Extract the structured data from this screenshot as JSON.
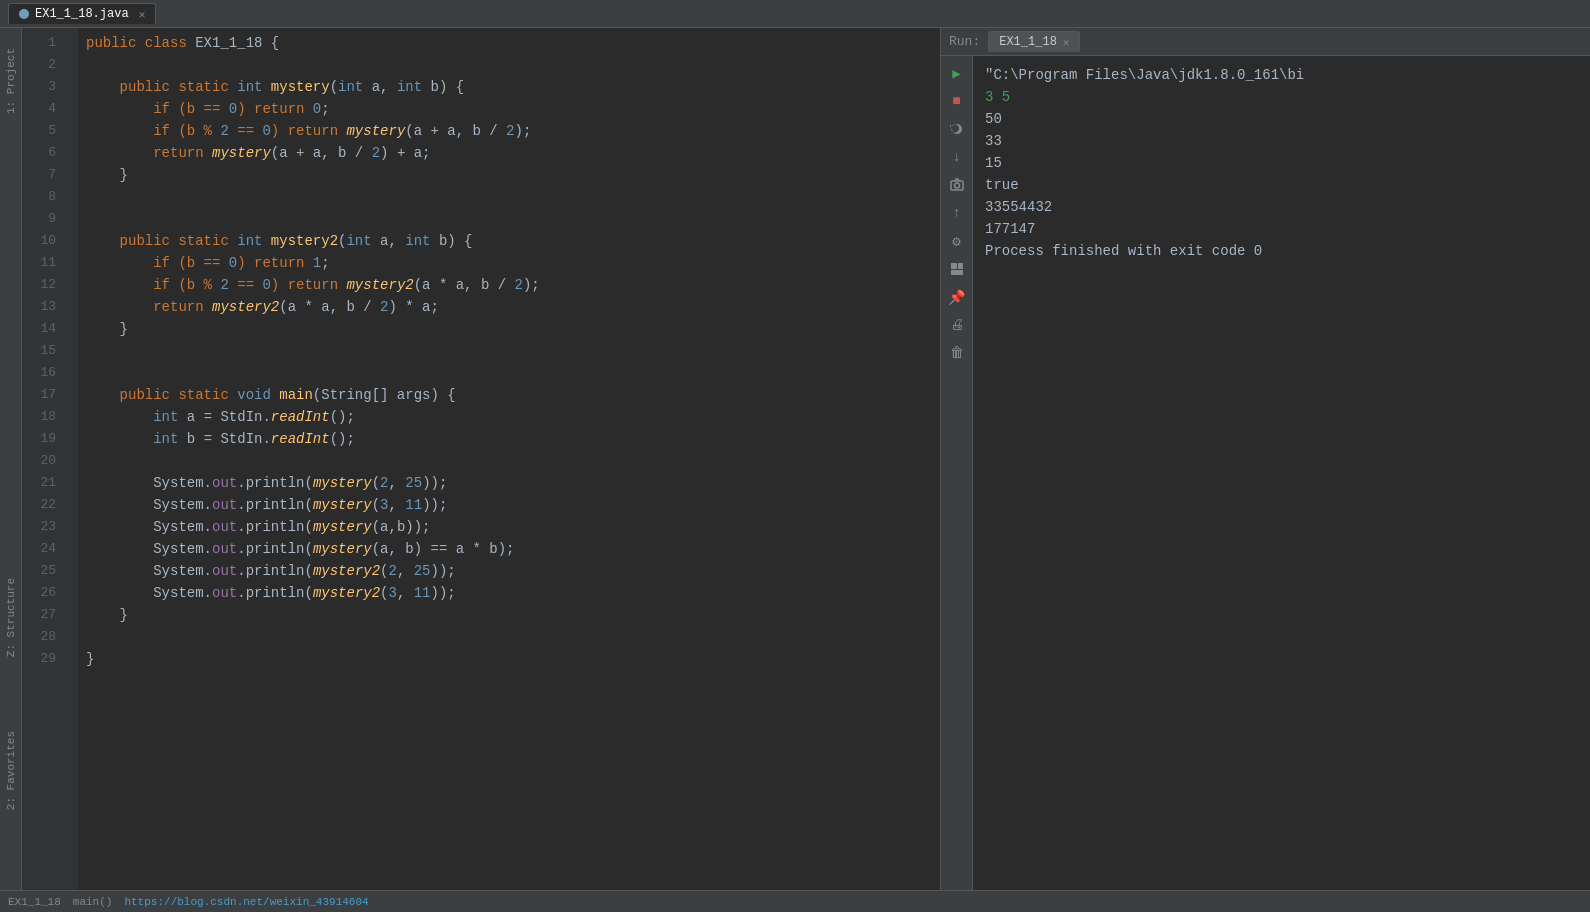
{
  "tabs": [
    {
      "id": "tab-ex1",
      "label": "EX1_1_18.java",
      "active": true,
      "icon_color": "#6d9fbd"
    }
  ],
  "editor": {
    "code_lines": [
      {
        "ln": 1,
        "tokens": [
          {
            "t": "public class ",
            "c": "kw"
          },
          {
            "t": "EX1_1_18 {",
            "c": "param"
          }
        ]
      },
      {
        "ln": 2,
        "tokens": []
      },
      {
        "ln": 3,
        "tokens": [
          {
            "t": "    public static ",
            "c": "kw"
          },
          {
            "t": "int ",
            "c": "kw-blue"
          },
          {
            "t": "mystery",
            "c": "fn"
          },
          {
            "t": "(",
            "c": "param"
          },
          {
            "t": "int ",
            "c": "kw-blue"
          },
          {
            "t": "a, ",
            "c": "param"
          },
          {
            "t": "int ",
            "c": "kw-blue"
          },
          {
            "t": "b) {",
            "c": "param"
          }
        ]
      },
      {
        "ln": 4,
        "tokens": [
          {
            "t": "        if (b == ",
            "c": "kw"
          },
          {
            "t": "0",
            "c": "num"
          },
          {
            "t": ") return ",
            "c": "kw"
          },
          {
            "t": "0",
            "c": "num"
          },
          {
            "t": ";",
            "c": "param"
          }
        ]
      },
      {
        "ln": 5,
        "tokens": [
          {
            "t": "        if (b % ",
            "c": "kw"
          },
          {
            "t": "2",
            "c": "num"
          },
          {
            "t": " == ",
            "c": "kw"
          },
          {
            "t": "0",
            "c": "num"
          },
          {
            "t": ") return ",
            "c": "kw"
          },
          {
            "t": "mystery",
            "c": "fn-italic"
          },
          {
            "t": "(a + a, b / ",
            "c": "param"
          },
          {
            "t": "2",
            "c": "num"
          },
          {
            "t": ");",
            "c": "param"
          }
        ]
      },
      {
        "ln": 6,
        "tokens": [
          {
            "t": "        return ",
            "c": "kw"
          },
          {
            "t": "mystery",
            "c": "fn-italic"
          },
          {
            "t": "(a + a, b / ",
            "c": "param"
          },
          {
            "t": "2",
            "c": "num"
          },
          {
            "t": ") + a;",
            "c": "param"
          }
        ]
      },
      {
        "ln": 7,
        "tokens": [
          {
            "t": "    }",
            "c": "param"
          }
        ]
      },
      {
        "ln": 8,
        "tokens": []
      },
      {
        "ln": 9,
        "tokens": []
      },
      {
        "ln": 10,
        "tokens": [
          {
            "t": "    public static ",
            "c": "kw"
          },
          {
            "t": "int ",
            "c": "kw-blue"
          },
          {
            "t": "mystery2",
            "c": "fn"
          },
          {
            "t": "(",
            "c": "param"
          },
          {
            "t": "int ",
            "c": "kw-blue"
          },
          {
            "t": "a, ",
            "c": "param"
          },
          {
            "t": "int ",
            "c": "kw-blue"
          },
          {
            "t": "b) {",
            "c": "param"
          }
        ]
      },
      {
        "ln": 11,
        "tokens": [
          {
            "t": "        if (b == ",
            "c": "kw"
          },
          {
            "t": "0",
            "c": "num"
          },
          {
            "t": ") return ",
            "c": "kw"
          },
          {
            "t": "1",
            "c": "num"
          },
          {
            "t": ";",
            "c": "param"
          }
        ]
      },
      {
        "ln": 12,
        "tokens": [
          {
            "t": "        if (b % ",
            "c": "kw"
          },
          {
            "t": "2",
            "c": "num"
          },
          {
            "t": " == ",
            "c": "kw"
          },
          {
            "t": "0",
            "c": "num"
          },
          {
            "t": ") return ",
            "c": "kw"
          },
          {
            "t": "mystery2",
            "c": "fn-italic"
          },
          {
            "t": "(a * a, b / ",
            "c": "param"
          },
          {
            "t": "2",
            "c": "num"
          },
          {
            "t": ");",
            "c": "param"
          }
        ]
      },
      {
        "ln": 13,
        "tokens": [
          {
            "t": "        return ",
            "c": "kw"
          },
          {
            "t": "mystery2",
            "c": "fn-italic"
          },
          {
            "t": "(a * a, b / ",
            "c": "param"
          },
          {
            "t": "2",
            "c": "num"
          },
          {
            "t": ") * a;",
            "c": "param"
          }
        ]
      },
      {
        "ln": 14,
        "tokens": [
          {
            "t": "    }",
            "c": "param"
          }
        ]
      },
      {
        "ln": 15,
        "tokens": []
      },
      {
        "ln": 16,
        "tokens": []
      },
      {
        "ln": 17,
        "tokens": [
          {
            "t": "    public static ",
            "c": "kw"
          },
          {
            "t": "void ",
            "c": "kw-blue"
          },
          {
            "t": "main",
            "c": "fn"
          },
          {
            "t": "(String[] args) {",
            "c": "param"
          }
        ]
      },
      {
        "ln": 18,
        "tokens": [
          {
            "t": "        ",
            "c": "param"
          },
          {
            "t": "int ",
            "c": "kw-blue"
          },
          {
            "t": "a = StdIn.",
            "c": "param"
          },
          {
            "t": "readInt",
            "c": "fn-italic"
          },
          {
            "t": "();",
            "c": "param"
          }
        ]
      },
      {
        "ln": 19,
        "tokens": [
          {
            "t": "        ",
            "c": "param"
          },
          {
            "t": "int ",
            "c": "kw-blue"
          },
          {
            "t": "b = StdIn.",
            "c": "param"
          },
          {
            "t": "readInt",
            "c": "fn-italic"
          },
          {
            "t": "();",
            "c": "param"
          }
        ]
      },
      {
        "ln": 20,
        "tokens": []
      },
      {
        "ln": 21,
        "tokens": [
          {
            "t": "        System.",
            "c": "param"
          },
          {
            "t": "out",
            "c": "field"
          },
          {
            "t": ".println(",
            "c": "param"
          },
          {
            "t": "mystery",
            "c": "fn-italic"
          },
          {
            "t": "(",
            "c": "param"
          },
          {
            "t": "2",
            "c": "num"
          },
          {
            "t": ", ",
            "c": "param"
          },
          {
            "t": "25",
            "c": "num"
          },
          {
            "t": "));",
            "c": "param"
          }
        ]
      },
      {
        "ln": 22,
        "tokens": [
          {
            "t": "        System.",
            "c": "param"
          },
          {
            "t": "out",
            "c": "field"
          },
          {
            "t": ".println(",
            "c": "param"
          },
          {
            "t": "mystery",
            "c": "fn-italic"
          },
          {
            "t": "(",
            "c": "param"
          },
          {
            "t": "3",
            "c": "num"
          },
          {
            "t": ", ",
            "c": "param"
          },
          {
            "t": "11",
            "c": "num"
          },
          {
            "t": "));",
            "c": "param"
          }
        ]
      },
      {
        "ln": 23,
        "tokens": [
          {
            "t": "        System.",
            "c": "param"
          },
          {
            "t": "out",
            "c": "field"
          },
          {
            "t": ".println(",
            "c": "param"
          },
          {
            "t": "mystery",
            "c": "fn-italic"
          },
          {
            "t": "(a,b));",
            "c": "param"
          }
        ]
      },
      {
        "ln": 24,
        "tokens": [
          {
            "t": "        System.",
            "c": "param"
          },
          {
            "t": "out",
            "c": "field"
          },
          {
            "t": ".println(",
            "c": "param"
          },
          {
            "t": "mystery",
            "c": "fn-italic"
          },
          {
            "t": "(a, b) == a * b);",
            "c": "param"
          }
        ]
      },
      {
        "ln": 25,
        "tokens": [
          {
            "t": "        System.",
            "c": "param"
          },
          {
            "t": "out",
            "c": "field"
          },
          {
            "t": ".println(",
            "c": "param"
          },
          {
            "t": "mystery2",
            "c": "fn-italic"
          },
          {
            "t": "(",
            "c": "param"
          },
          {
            "t": "2",
            "c": "num"
          },
          {
            "t": ", ",
            "c": "param"
          },
          {
            "t": "25",
            "c": "num"
          },
          {
            "t": "));",
            "c": "param"
          }
        ]
      },
      {
        "ln": 26,
        "tokens": [
          {
            "t": "        System.",
            "c": "param"
          },
          {
            "t": "out",
            "c": "field"
          },
          {
            "t": ".println(",
            "c": "param"
          },
          {
            "t": "mystery2",
            "c": "fn-italic"
          },
          {
            "t": "(",
            "c": "param"
          },
          {
            "t": "3",
            "c": "num"
          },
          {
            "t": ", ",
            "c": "param"
          },
          {
            "t": "11",
            "c": "num"
          },
          {
            "t": "));",
            "c": "param"
          }
        ]
      },
      {
        "ln": 27,
        "tokens": [
          {
            "t": "    }",
            "c": "param"
          }
        ]
      },
      {
        "ln": 28,
        "tokens": []
      },
      {
        "ln": 29,
        "tokens": [
          {
            "t": "}",
            "c": "param"
          }
        ]
      }
    ]
  },
  "run_panel": {
    "label": "Run:",
    "tab_label": "EX1_1_18",
    "command_line": "\"C:\\Program Files\\Java\\jdk1.8.0_161\\bi",
    "output_lines": [
      {
        "text": "3  5",
        "class": "output-line-green"
      },
      {
        "text": "50",
        "class": "output-line-normal"
      },
      {
        "text": "33",
        "class": "output-line-normal"
      },
      {
        "text": "15",
        "class": "output-line-normal"
      },
      {
        "text": "true",
        "class": "output-line-normal"
      },
      {
        "text": "33554432",
        "class": "output-line-normal"
      },
      {
        "text": "177147",
        "class": "output-line-normal"
      },
      {
        "text": "",
        "class": "output-line-normal"
      },
      {
        "text": "Process finished with exit code 0",
        "class": "output-line-normal"
      }
    ]
  },
  "bottom_bar": {
    "file_info": "EX1_1_18",
    "location": "main()",
    "url": "https://blog.csdn.net/weixin_43914604"
  },
  "sidebar_labels": {
    "project": "1: Project",
    "structure": "Z: Structure",
    "favorites": "2: Favorites"
  }
}
